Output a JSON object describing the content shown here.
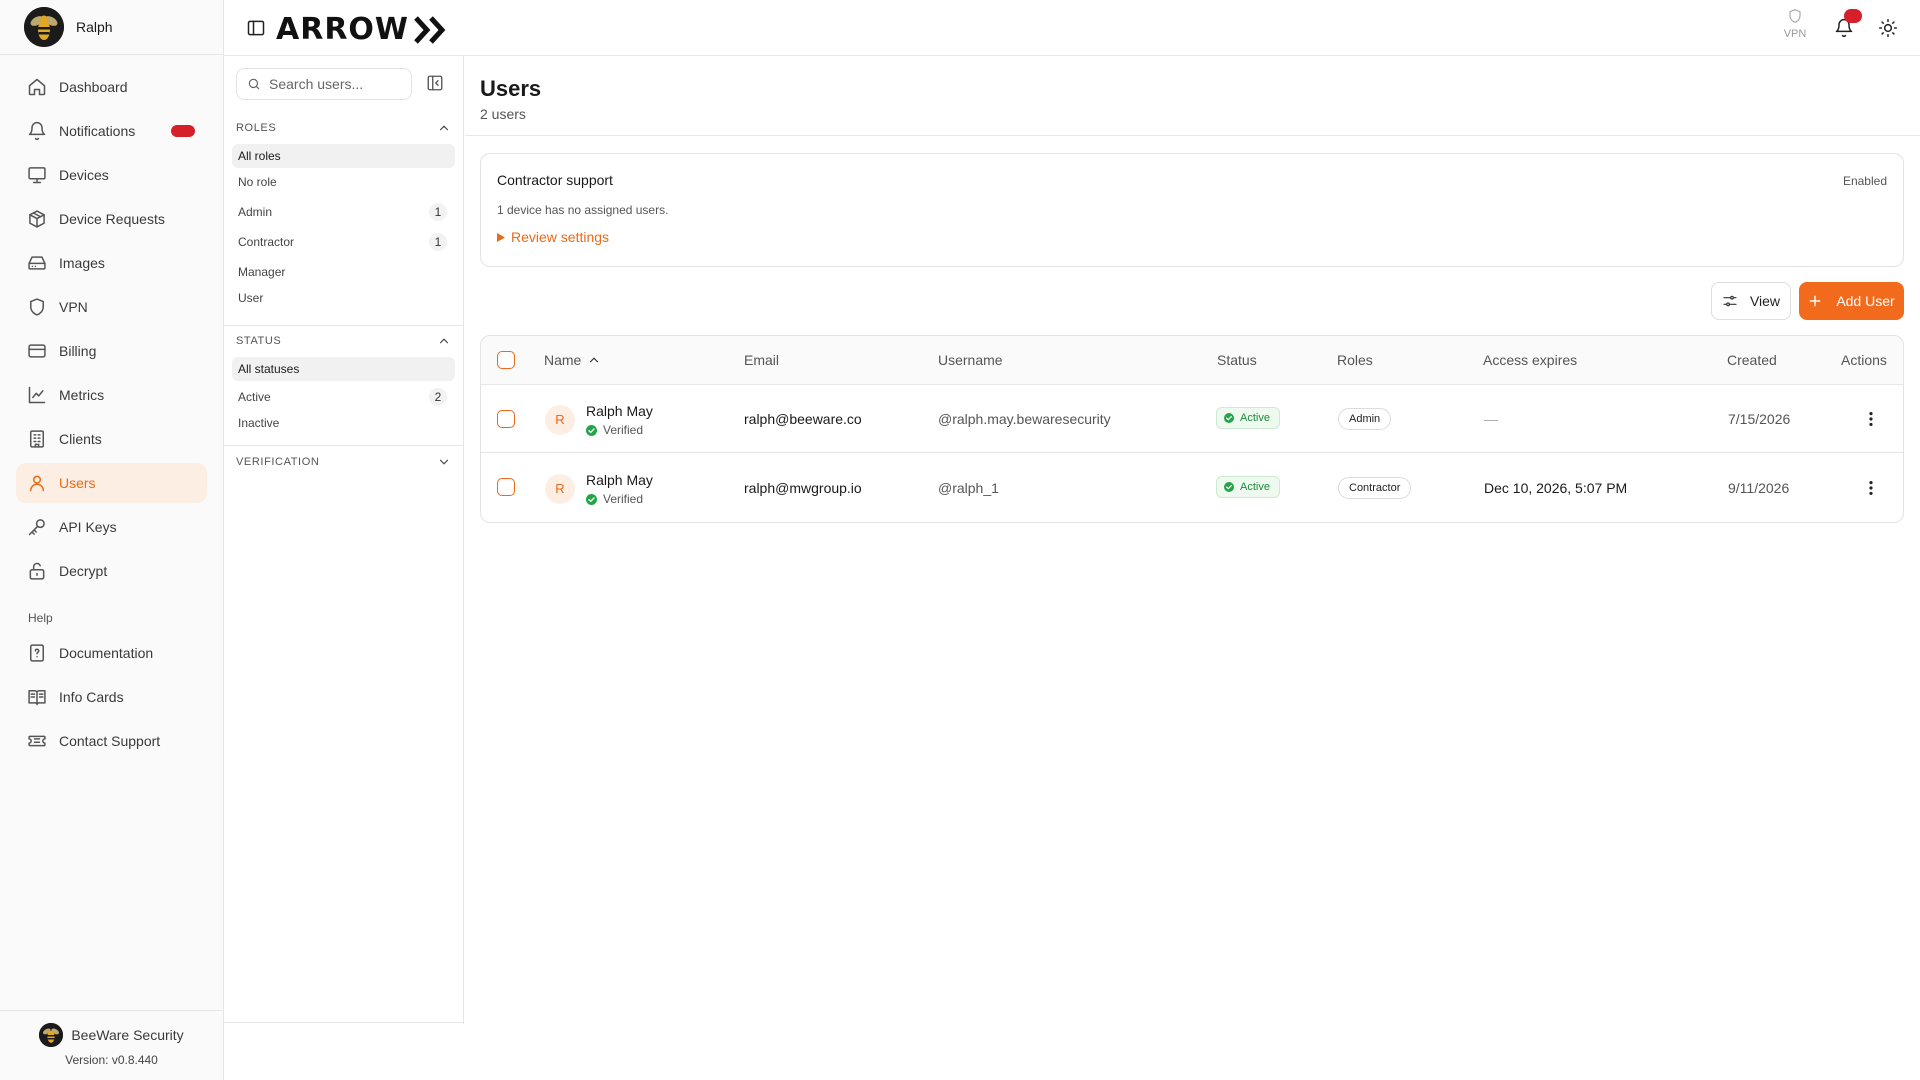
{
  "sidebar": {
    "org_user": "Ralph",
    "items": [
      {
        "label": "Dashboard",
        "icon": "home-icon",
        "active": false
      },
      {
        "label": "Notifications",
        "icon": "bell-icon",
        "active": false
      },
      {
        "label": "Devices",
        "icon": "monitor-icon",
        "active": false
      },
      {
        "label": "Device Requests",
        "icon": "package-icon",
        "active": false
      },
      {
        "label": "Images",
        "icon": "drive-icon",
        "active": false
      },
      {
        "label": "VPN",
        "icon": "shield-icon",
        "active": false
      },
      {
        "label": "Billing",
        "icon": "credit-card-icon",
        "active": false
      },
      {
        "label": "Metrics",
        "icon": "line-chart-icon",
        "active": false
      },
      {
        "label": "Clients",
        "icon": "building-icon",
        "active": false
      },
      {
        "label": "Users",
        "icon": "user-icon",
        "active": true
      },
      {
        "label": "API Keys",
        "icon": "key-icon",
        "active": false
      },
      {
        "label": "Decrypt",
        "icon": "unlock-icon",
        "active": false
      }
    ],
    "help_heading": "Help",
    "help_items": [
      {
        "label": "Documentation",
        "icon": "help-file-icon"
      },
      {
        "label": "Info Cards",
        "icon": "book-icon"
      },
      {
        "label": "Contact Support",
        "icon": "ticket-icon"
      }
    ],
    "footer": {
      "org_name": "BeeWare Security",
      "version": "Version: v0.8.440"
    }
  },
  "header": {
    "logo_text": "ARROW",
    "vpn_label": "VPN"
  },
  "filters": {
    "search_placeholder": "Search users...",
    "roles": {
      "heading": "ROLES",
      "options": [
        {
          "label": "All roles",
          "count": null,
          "selected": true
        },
        {
          "label": "No role",
          "count": null,
          "selected": false
        },
        {
          "label": "Admin",
          "count": "1",
          "selected": false
        },
        {
          "label": "Contractor",
          "count": "1",
          "selected": false
        },
        {
          "label": "Manager",
          "count": null,
          "selected": false
        },
        {
          "label": "User",
          "count": null,
          "selected": false
        }
      ]
    },
    "status": {
      "heading": "STATUS",
      "options": [
        {
          "label": "All statuses",
          "count": null,
          "selected": true
        },
        {
          "label": "Active",
          "count": "2",
          "selected": false
        },
        {
          "label": "Inactive",
          "count": null,
          "selected": false
        }
      ]
    },
    "verification": {
      "heading": "VERIFICATION"
    }
  },
  "main": {
    "title": "Users",
    "subtitle": "2 users",
    "notice": {
      "title": "Contractor support",
      "status": "Enabled",
      "description": "1 device has no assigned users.",
      "link": "Review settings"
    },
    "view_label": "View",
    "add_label": "Add User",
    "table": {
      "columns": [
        "Name",
        "Email",
        "Username",
        "Status",
        "Roles",
        "Access expires",
        "Created",
        "Actions"
      ],
      "rows": [
        {
          "initial": "R",
          "name": "Ralph May",
          "verified": "Verified",
          "email": "ralph@beeware.co",
          "username": "@ralph.may.bewaresecurity",
          "status": "Active",
          "role": "Admin",
          "expires": "—",
          "created": "7/15/2026"
        },
        {
          "initial": "R",
          "name": "Ralph May",
          "verified": "Verified",
          "email": "ralph@mwgroup.io",
          "username": "@ralph_1",
          "status": "Active",
          "role": "Contractor",
          "expires": "Dec 10, 2026, 5:07 PM",
          "created": "9/11/2026"
        }
      ]
    }
  },
  "colors": {
    "accent": "#f26b1d",
    "active_bg": "#fdeee3",
    "badge_red": "#d61f2a",
    "success": "#1e8b3a"
  }
}
